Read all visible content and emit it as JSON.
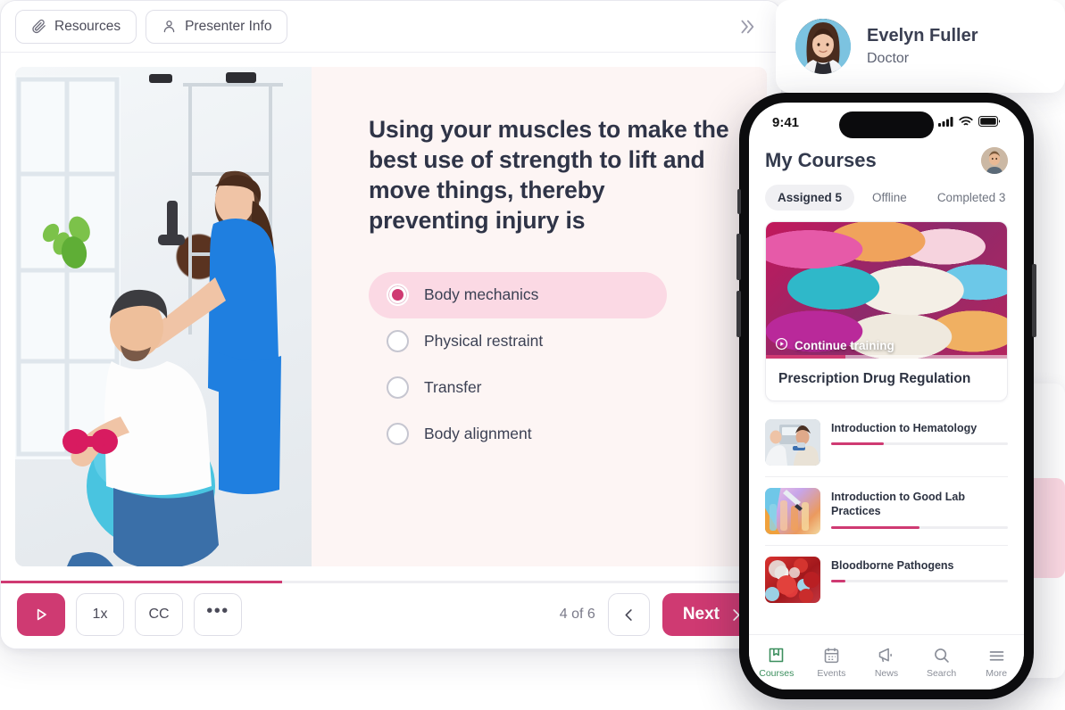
{
  "player": {
    "topbar": {
      "resources_label": "Resources",
      "presenter_info_label": "Presenter Info",
      "collapse_icon": "double-chevron-right-icon"
    },
    "slide": {
      "question": "Using your muscles to make the best use of strength to lift and move things, thereby preventing injury is",
      "options": [
        {
          "label": "Body mechanics",
          "selected": true
        },
        {
          "label": "Physical restraint",
          "selected": false
        },
        {
          "label": "Transfer",
          "selected": false
        },
        {
          "label": "Body alignment",
          "selected": false
        }
      ],
      "photo_alt": "physical-therapist-assisting-patient-with-dumbbells"
    },
    "controls": {
      "play_label": "play-icon",
      "speed_label": "1x",
      "captions_label": "CC",
      "more_label": "•••",
      "page_count": "4 of 6",
      "prev_label": "chevron-left-icon",
      "next_label": "Next",
      "progress_percent": 36
    },
    "accent_color": "#cf3a72",
    "progress_color": "#cf3a72"
  },
  "presenter": {
    "name": "Evelyn Fuller",
    "role": "Doctor",
    "avatar_alt": "evelyn-fuller-portrait"
  },
  "phone": {
    "status_bar": {
      "time": "9:41",
      "cellular_icon": "cellular-bars-icon",
      "wifi_icon": "wifi-icon",
      "battery_icon": "battery-icon"
    },
    "header": {
      "title": "My Courses",
      "avatar_alt": "user-profile-photo"
    },
    "tabs": [
      {
        "label": "Assigned 5",
        "active": true
      },
      {
        "label": "Offline",
        "active": false
      },
      {
        "label": "Completed 3",
        "active": false
      }
    ],
    "featured_course": {
      "continue_label": "Continue training",
      "title": "Prescription Drug Regulation",
      "progress_percent": 33,
      "image_alt": "colorful-pills-and-capsules"
    },
    "course_list": [
      {
        "title": "Introduction to Hematology",
        "progress_percent": 30,
        "image_alt": "nurse-drawing-blood-from-patient"
      },
      {
        "title": "Introduction to Good Lab Practices",
        "progress_percent": 50,
        "image_alt": "laboratory-test-tubes-pipette"
      },
      {
        "title": "Bloodborne Pathogens",
        "progress_percent": 8,
        "image_alt": "blood-cells-microscopic"
      }
    ],
    "tabbar": [
      {
        "label": "Courses",
        "icon": "book-icon",
        "active": true
      },
      {
        "label": "Events",
        "icon": "calendar-icon",
        "active": false
      },
      {
        "label": "News",
        "icon": "megaphone-icon",
        "active": false
      },
      {
        "label": "Search",
        "icon": "search-icon",
        "active": false
      },
      {
        "label": "More",
        "icon": "hamburger-menu-icon",
        "active": false
      }
    ],
    "active_color": "#3c8f5e",
    "accent_color": "#cf3a72"
  }
}
